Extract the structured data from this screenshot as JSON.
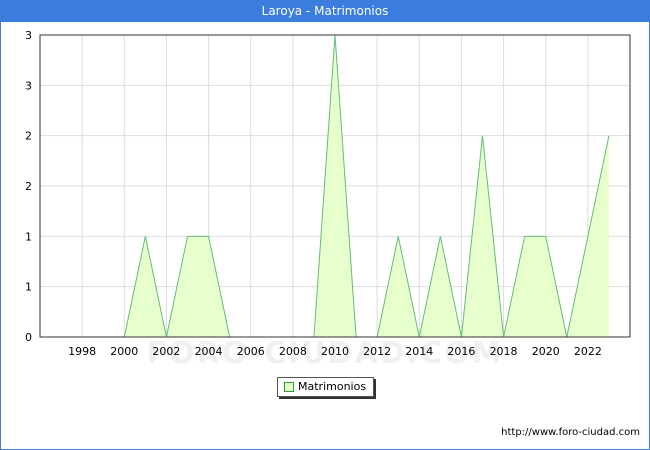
{
  "header": {
    "title": "Laroya - Matrimonios"
  },
  "footer": {
    "url": "http://www.foro-ciudad.com",
    "watermark": "FORO-CIUDAD.COM"
  },
  "legend": {
    "label": "Matrimonios"
  },
  "colors": {
    "header_bg": "#3b7ddd",
    "area_fill": "#e6ffcc",
    "area_line": "#66bb77",
    "grid": "#dddddd"
  },
  "chart_data": {
    "type": "area",
    "title": "Laroya - Matrimonios",
    "xlabel": "",
    "ylabel": "",
    "x": [
      2000,
      2001,
      2002,
      2003,
      2004,
      2005,
      2006,
      2007,
      2008,
      2009,
      2010,
      2011,
      2012,
      2013,
      2014,
      2015,
      2016,
      2017,
      2018,
      2019,
      2020,
      2021,
      2022,
      2023
    ],
    "series": [
      {
        "name": "Matrimonios",
        "values": [
          0,
          1,
          0,
          1,
          1,
          0,
          0,
          0,
          0,
          0,
          3,
          0,
          0,
          1,
          0,
          1,
          0,
          2,
          0,
          1,
          1,
          0,
          1,
          2
        ]
      }
    ],
    "xlim": [
      1996,
      2024
    ],
    "ylim": [
      0,
      3
    ],
    "x_ticks": [
      "1998",
      "2000",
      "2002",
      "2004",
      "2006",
      "2008",
      "2010",
      "2012",
      "2014",
      "2016",
      "2018",
      "2020",
      "2022"
    ],
    "y_ticks": [
      "0",
      "1",
      "1",
      "2",
      "2",
      "3",
      "3"
    ],
    "grid": true,
    "legend_position": "bottom-center"
  }
}
